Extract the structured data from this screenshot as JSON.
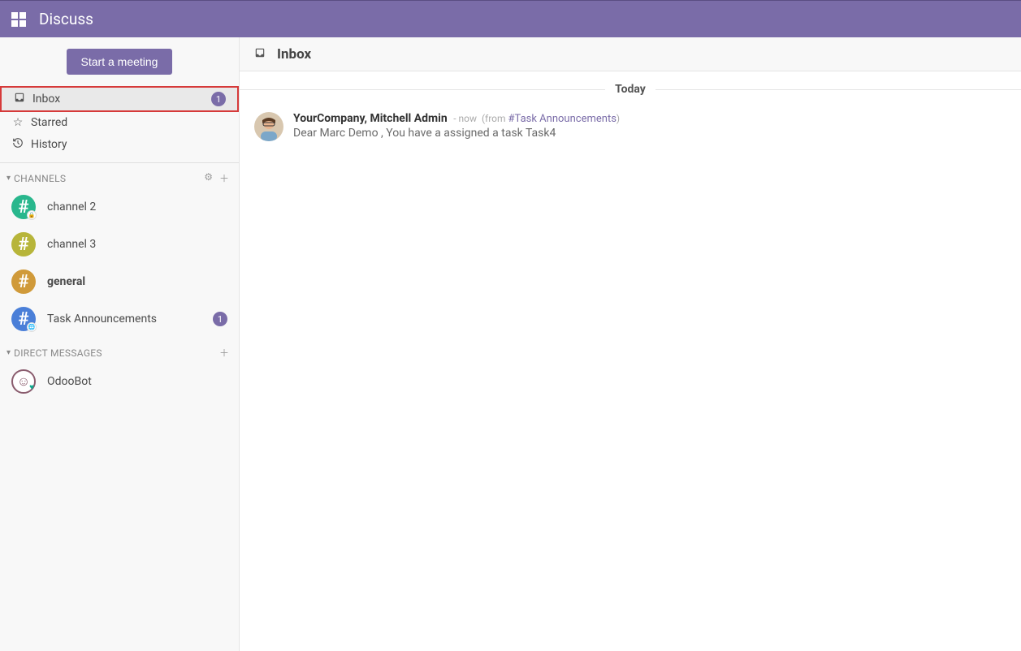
{
  "app_title": "Discuss",
  "sidebar": {
    "meeting_btn": "Start a meeting",
    "mailboxes": {
      "inbox": {
        "label": "Inbox",
        "badge": "1"
      },
      "starred": {
        "label": "Starred"
      },
      "history": {
        "label": "History"
      }
    },
    "channels_header": "CHANNELS",
    "channels": [
      {
        "label": "channel 2",
        "color": "#29b78d",
        "sub": "lock",
        "bold": false,
        "badge": ""
      },
      {
        "label": "channel 3",
        "color": "#b7b53a",
        "sub": "",
        "bold": false,
        "badge": ""
      },
      {
        "label": "general",
        "color": "#d09a3a",
        "sub": "",
        "bold": true,
        "badge": ""
      },
      {
        "label": "Task Announcements",
        "color": "#4a7fd8",
        "sub": "globe",
        "bold": false,
        "badge": "1"
      }
    ],
    "dm_header": "DIRECT MESSAGES",
    "dms": [
      {
        "label": "OdooBot"
      }
    ]
  },
  "main": {
    "header_title": "Inbox",
    "date_separator": "Today",
    "message": {
      "author": "YourCompany, Mitchell Admin",
      "time_prefix": "- ",
      "time": "now",
      "from_label": "(from ",
      "channel_link": "#Task Announcements",
      "from_close": ")",
      "body": "Dear Marc Demo , You have a assigned a task Task4"
    }
  }
}
